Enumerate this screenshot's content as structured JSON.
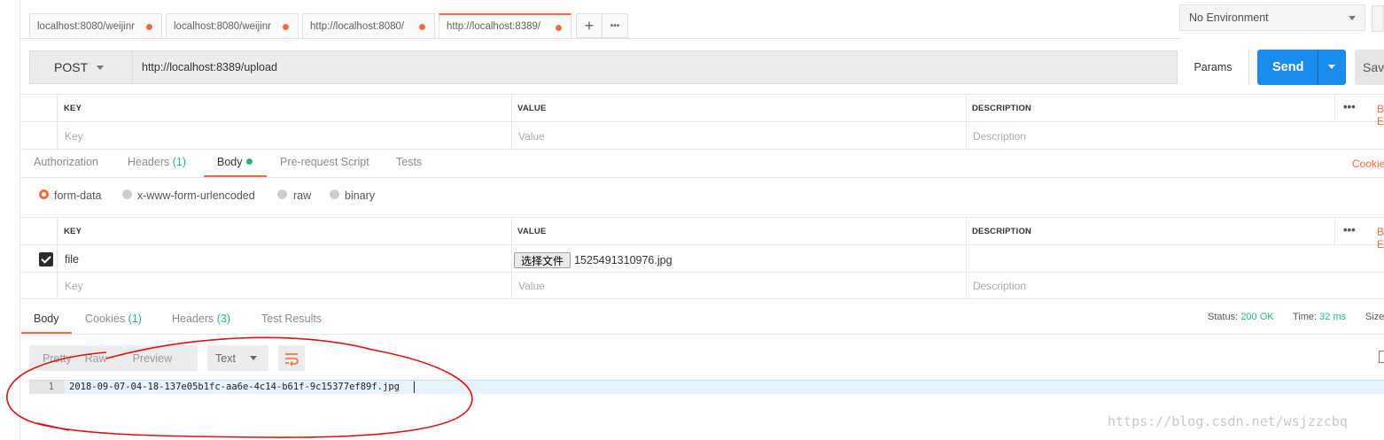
{
  "tabs": [
    {
      "label": "localhost:8080/weijinr",
      "active": false
    },
    {
      "label": "localhost:8080/weijinr",
      "active": false
    },
    {
      "label": "http://localhost:8080/",
      "active": false
    },
    {
      "label": "http://localhost:8389/",
      "active": true
    }
  ],
  "tab_actions": {
    "new_tab": "+",
    "more": "•••"
  },
  "environment": {
    "selected": "No Environment"
  },
  "request": {
    "method": "POST",
    "url": "http://localhost:8389/upload",
    "params_label": "Params",
    "send_label": "Send",
    "save_label": "Save"
  },
  "params_table": {
    "headers": [
      "KEY",
      "VALUE",
      "DESCRIPTION"
    ],
    "placeholders": [
      "Key",
      "Value",
      "Description"
    ],
    "more": "•••",
    "bulk": "Bulk Edit"
  },
  "request_tabs": [
    {
      "label": "Authorization",
      "active": false
    },
    {
      "label": "Headers",
      "count": "(1)",
      "active": false
    },
    {
      "label": "Body",
      "active": true,
      "indicator": true
    },
    {
      "label": "Pre-request Script",
      "active": false
    },
    {
      "label": "Tests",
      "active": false
    }
  ],
  "cookies_link": "Cookies",
  "body_types": [
    {
      "label": "form-data",
      "selected": true
    },
    {
      "label": "x-www-form-urlencoded",
      "selected": false
    },
    {
      "label": "raw",
      "selected": false
    },
    {
      "label": "binary",
      "selected": false
    }
  ],
  "form_table": {
    "headers": [
      "KEY",
      "VALUE",
      "DESCRIPTION"
    ],
    "rows": [
      {
        "checked": true,
        "key": "file",
        "file_button": "选择文件",
        "file_name": "1525491310976.jpg"
      }
    ],
    "placeholders": [
      "Key",
      "Value",
      "Description"
    ],
    "more": "•••",
    "bulk": "Bulk Edit"
  },
  "response_tabs": [
    {
      "label": "Body",
      "active": true
    },
    {
      "label": "Cookies",
      "count": "(1)",
      "active": false
    },
    {
      "label": "Headers",
      "count": "(3)",
      "active": false
    },
    {
      "label": "Test Results",
      "active": false
    }
  ],
  "response_status": {
    "status_label": "Status:",
    "status_value": "200 OK",
    "time_label": "Time:",
    "time_value": "32 ms",
    "size_label": "Size"
  },
  "response_view": {
    "modes": [
      "Pretty",
      "Raw",
      "Preview"
    ],
    "format": "Text",
    "line_number": "1",
    "content": "2018-09-07-04-18-137e05b1fc-aa6e-4c14-b61f-9c15377ef89f.jpg"
  },
  "watermark": "https://blog.csdn.net/wsjzzcbq",
  "colors": {
    "accent": "#f26b3a",
    "send": "#1b8ceb",
    "success": "#26b47f",
    "annotation": "#e01010"
  }
}
